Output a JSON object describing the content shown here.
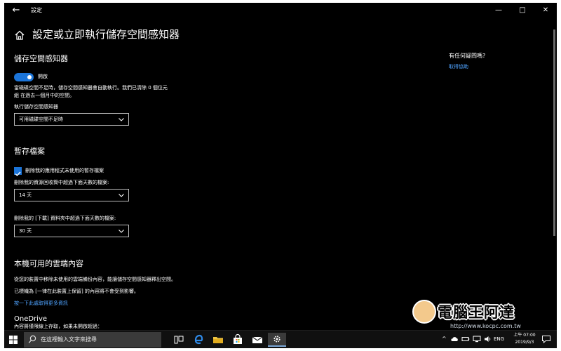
{
  "window": {
    "title": "設定",
    "back_glyph": "←",
    "minimize_glyph": "—",
    "maximize_glyph": "□",
    "close_glyph": "✕"
  },
  "header": {
    "title": "設定或立即執行儲存空間感知器"
  },
  "storage_sense": {
    "title": "儲存空間感知器",
    "toggle_label": "開啟",
    "toggle_on": true,
    "description_line1": "當磁碟空間不足時，儲存空間感知器會自動執行。我們已清除 0 個位元",
    "description_line2": "組 在過去一個月中的空間。",
    "run_label": "執行儲存空間感知器",
    "run_value": "可用磁碟空間不足時"
  },
  "temp_files": {
    "title": "暫存檔案",
    "checkbox_label": "刪除我的應用程式未使用的暫存檔案",
    "checkbox_checked": true,
    "recycle_label": "刪除我的資源回收筒中超過下面天數的檔案:",
    "recycle_value": "14 天",
    "downloads_label": "刪除我的 [下載] 資料夾中超過下面天數的檔案:",
    "downloads_value": "30 天"
  },
  "cloud": {
    "title": "本機可用的雲端內容",
    "desc1": "從您的裝置中移除未使用的雲端備份內容，能讓儲存空間感知器釋出空間。",
    "desc2": "已標幟為 [一律在此裝置上保留] 的內容將不會受到影響。",
    "link": "按一下此處取得更多資訊",
    "onedrive_title": "OneDrive",
    "onedrive_desc": "內容將僅限線上存取，如果未開啟超過："
  },
  "help": {
    "title": "有任何疑問嗎?",
    "link": "取得協助"
  },
  "taskbar": {
    "search_placeholder": "在這裡輸入文字來搜尋",
    "language": "ENG",
    "time": "上午 07:00",
    "date": "2019/9/3"
  },
  "watermark": {
    "text": "電腦王阿達",
    "url": "http://www.kocpc.com.tw"
  },
  "colors": {
    "accent": "#1b74d8",
    "link": "#4fa3ff",
    "background": "#000000",
    "taskbar": "#101010"
  },
  "icons": [
    "back-icon",
    "minimize-icon",
    "maximize-icon",
    "close-icon",
    "home-icon",
    "chevron-down-icon",
    "checkmark-icon",
    "windows-start-icon",
    "search-icon",
    "task-view-icon",
    "edge-icon",
    "file-explorer-icon",
    "store-icon",
    "mail-icon",
    "settings-icon",
    "notification-icon"
  ]
}
